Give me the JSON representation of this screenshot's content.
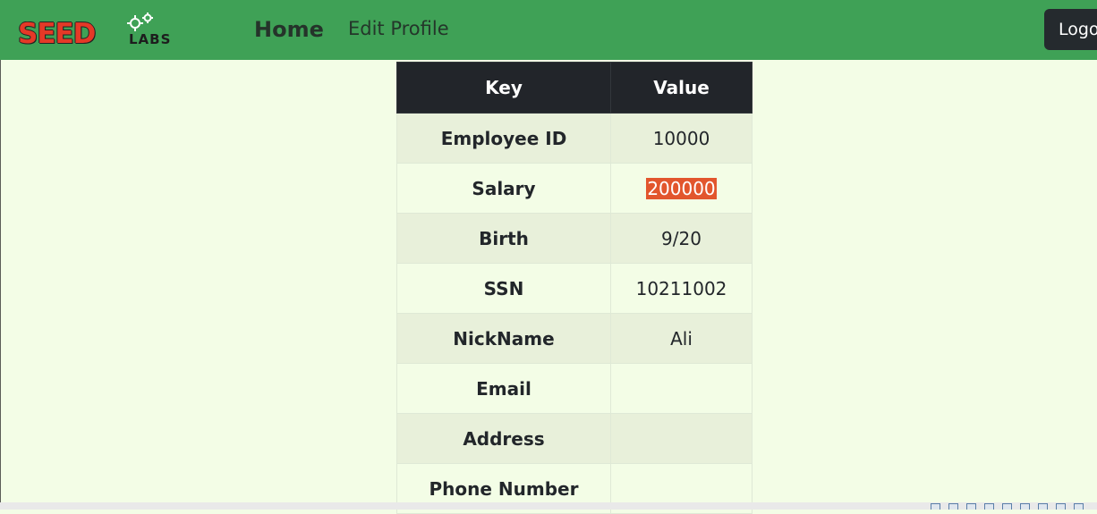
{
  "logo": {
    "seed_text": "SEED",
    "labs_text": "LABS"
  },
  "nav": {
    "home": "Home",
    "edit_profile": "Edit Profile",
    "logout": "Logout"
  },
  "table": {
    "headers": [
      "Key",
      "Value"
    ],
    "rows": [
      {
        "key": "Employee ID",
        "value": "10000"
      },
      {
        "key": "Salary",
        "value": "200000"
      },
      {
        "key": "Birth",
        "value": "9/20"
      },
      {
        "key": "SSN",
        "value": "10211002"
      },
      {
        "key": "NickName",
        "value": "Ali"
      },
      {
        "key": "Email",
        "value": ""
      },
      {
        "key": "Address",
        "value": ""
      },
      {
        "key": "Phone Number",
        "value": ""
      }
    ]
  },
  "colors": {
    "navbar": "#3fa156",
    "page_background": "#f3fde6",
    "table_header": "#22252a",
    "salary_highlight": "#e2562d",
    "logout_button": "#252a2e"
  }
}
